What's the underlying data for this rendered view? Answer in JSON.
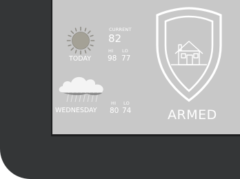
{
  "today": {
    "icon": "sun-icon",
    "day_label": "TODAY",
    "current_label": "CURRENT",
    "current_temp": "82",
    "hi_label": "HI",
    "lo_label": "LO",
    "hi": "98",
    "lo": "77"
  },
  "forecast": {
    "icon": "cloud-rain-icon",
    "day_label": "WEDNESDAY",
    "hi_label": "HI",
    "lo_label": "LO",
    "hi": "80",
    "lo": "74"
  },
  "security": {
    "icon": "shield-home-icon",
    "status": "ARMED"
  },
  "colors": {
    "screen": "#c8c8c8",
    "bezel": "#343637",
    "text": "#ffffff"
  }
}
